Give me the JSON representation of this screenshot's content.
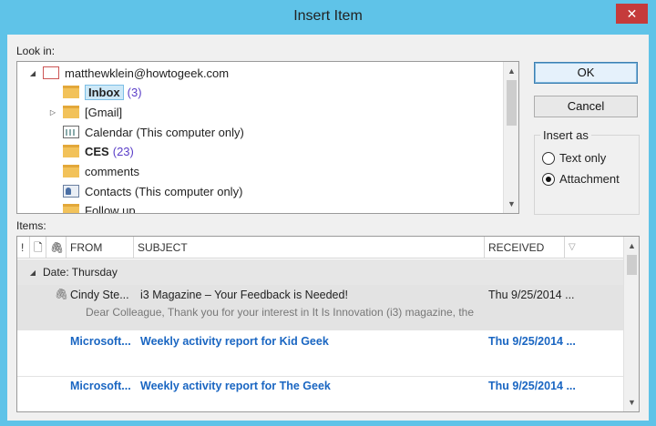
{
  "window": {
    "title": "Insert Item",
    "close_glyph": "✕"
  },
  "look_in_label": "Look in:",
  "tree": [
    {
      "label": "matthewklein@howtogeek.com",
      "icon": "mailbox-icon",
      "expander": "◢",
      "bold": false,
      "count": ""
    },
    {
      "label": "Inbox",
      "icon": "inbox-folder-icon",
      "expander": "",
      "bold": true,
      "count": "(3)",
      "selected": true
    },
    {
      "label": "[Gmail]",
      "icon": "folder-icon",
      "expander": "▷",
      "bold": false,
      "count": ""
    },
    {
      "label": "Calendar (This computer only)",
      "icon": "calendar-icon",
      "expander": "",
      "bold": false,
      "count": ""
    },
    {
      "label": "CES",
      "icon": "folder-icon",
      "expander": "",
      "bold": true,
      "count": "(23)"
    },
    {
      "label": "comments",
      "icon": "folder-icon",
      "expander": "",
      "bold": false,
      "count": ""
    },
    {
      "label": "Contacts (This computer only)",
      "icon": "contacts-icon",
      "expander": "",
      "bold": false,
      "count": ""
    },
    {
      "label": "Follow up",
      "icon": "folder-icon",
      "expander": "",
      "bold": false,
      "count": ""
    }
  ],
  "buttons": {
    "ok": "OK",
    "cancel": "Cancel"
  },
  "insert_as": {
    "title": "Insert as",
    "options": [
      "Text only",
      "Attachment"
    ],
    "selected": "Attachment"
  },
  "items_label": "Items:",
  "columns": {
    "importance": "!",
    "icon": "🗋",
    "attachment": "🖇",
    "from": "FROM",
    "subject": "SUBJECT",
    "received": "RECEIVED",
    "sort_glyph": "▽"
  },
  "group_header": "Date: Thursday",
  "messages": [
    {
      "from": "Cindy Ste...",
      "subject": "i3 Magazine – Your Feedback is Needed!",
      "received": "Thu 9/25/2014 ...",
      "preview": "Dear Colleague,  Thank you for your interest in It Is Innovation (i3) magazine, the",
      "unread": false,
      "attachment": true,
      "selected": true
    },
    {
      "from": "Microsoft...",
      "subject": "Weekly activity report for Kid Geek",
      "received": "Thu 9/25/2014 ...",
      "preview": "",
      "unread": true,
      "attachment": false,
      "selected": false
    },
    {
      "from": "Microsoft...",
      "subject": "Weekly activity report for The Geek",
      "received": "Thu 9/25/2014 ...",
      "preview": "",
      "unread": true,
      "attachment": false,
      "selected": false
    }
  ],
  "colors": {
    "frame": "#5fc3e8",
    "unread": "#1a66c2",
    "count": "#5a3ec8",
    "close": "#c53b3b"
  }
}
